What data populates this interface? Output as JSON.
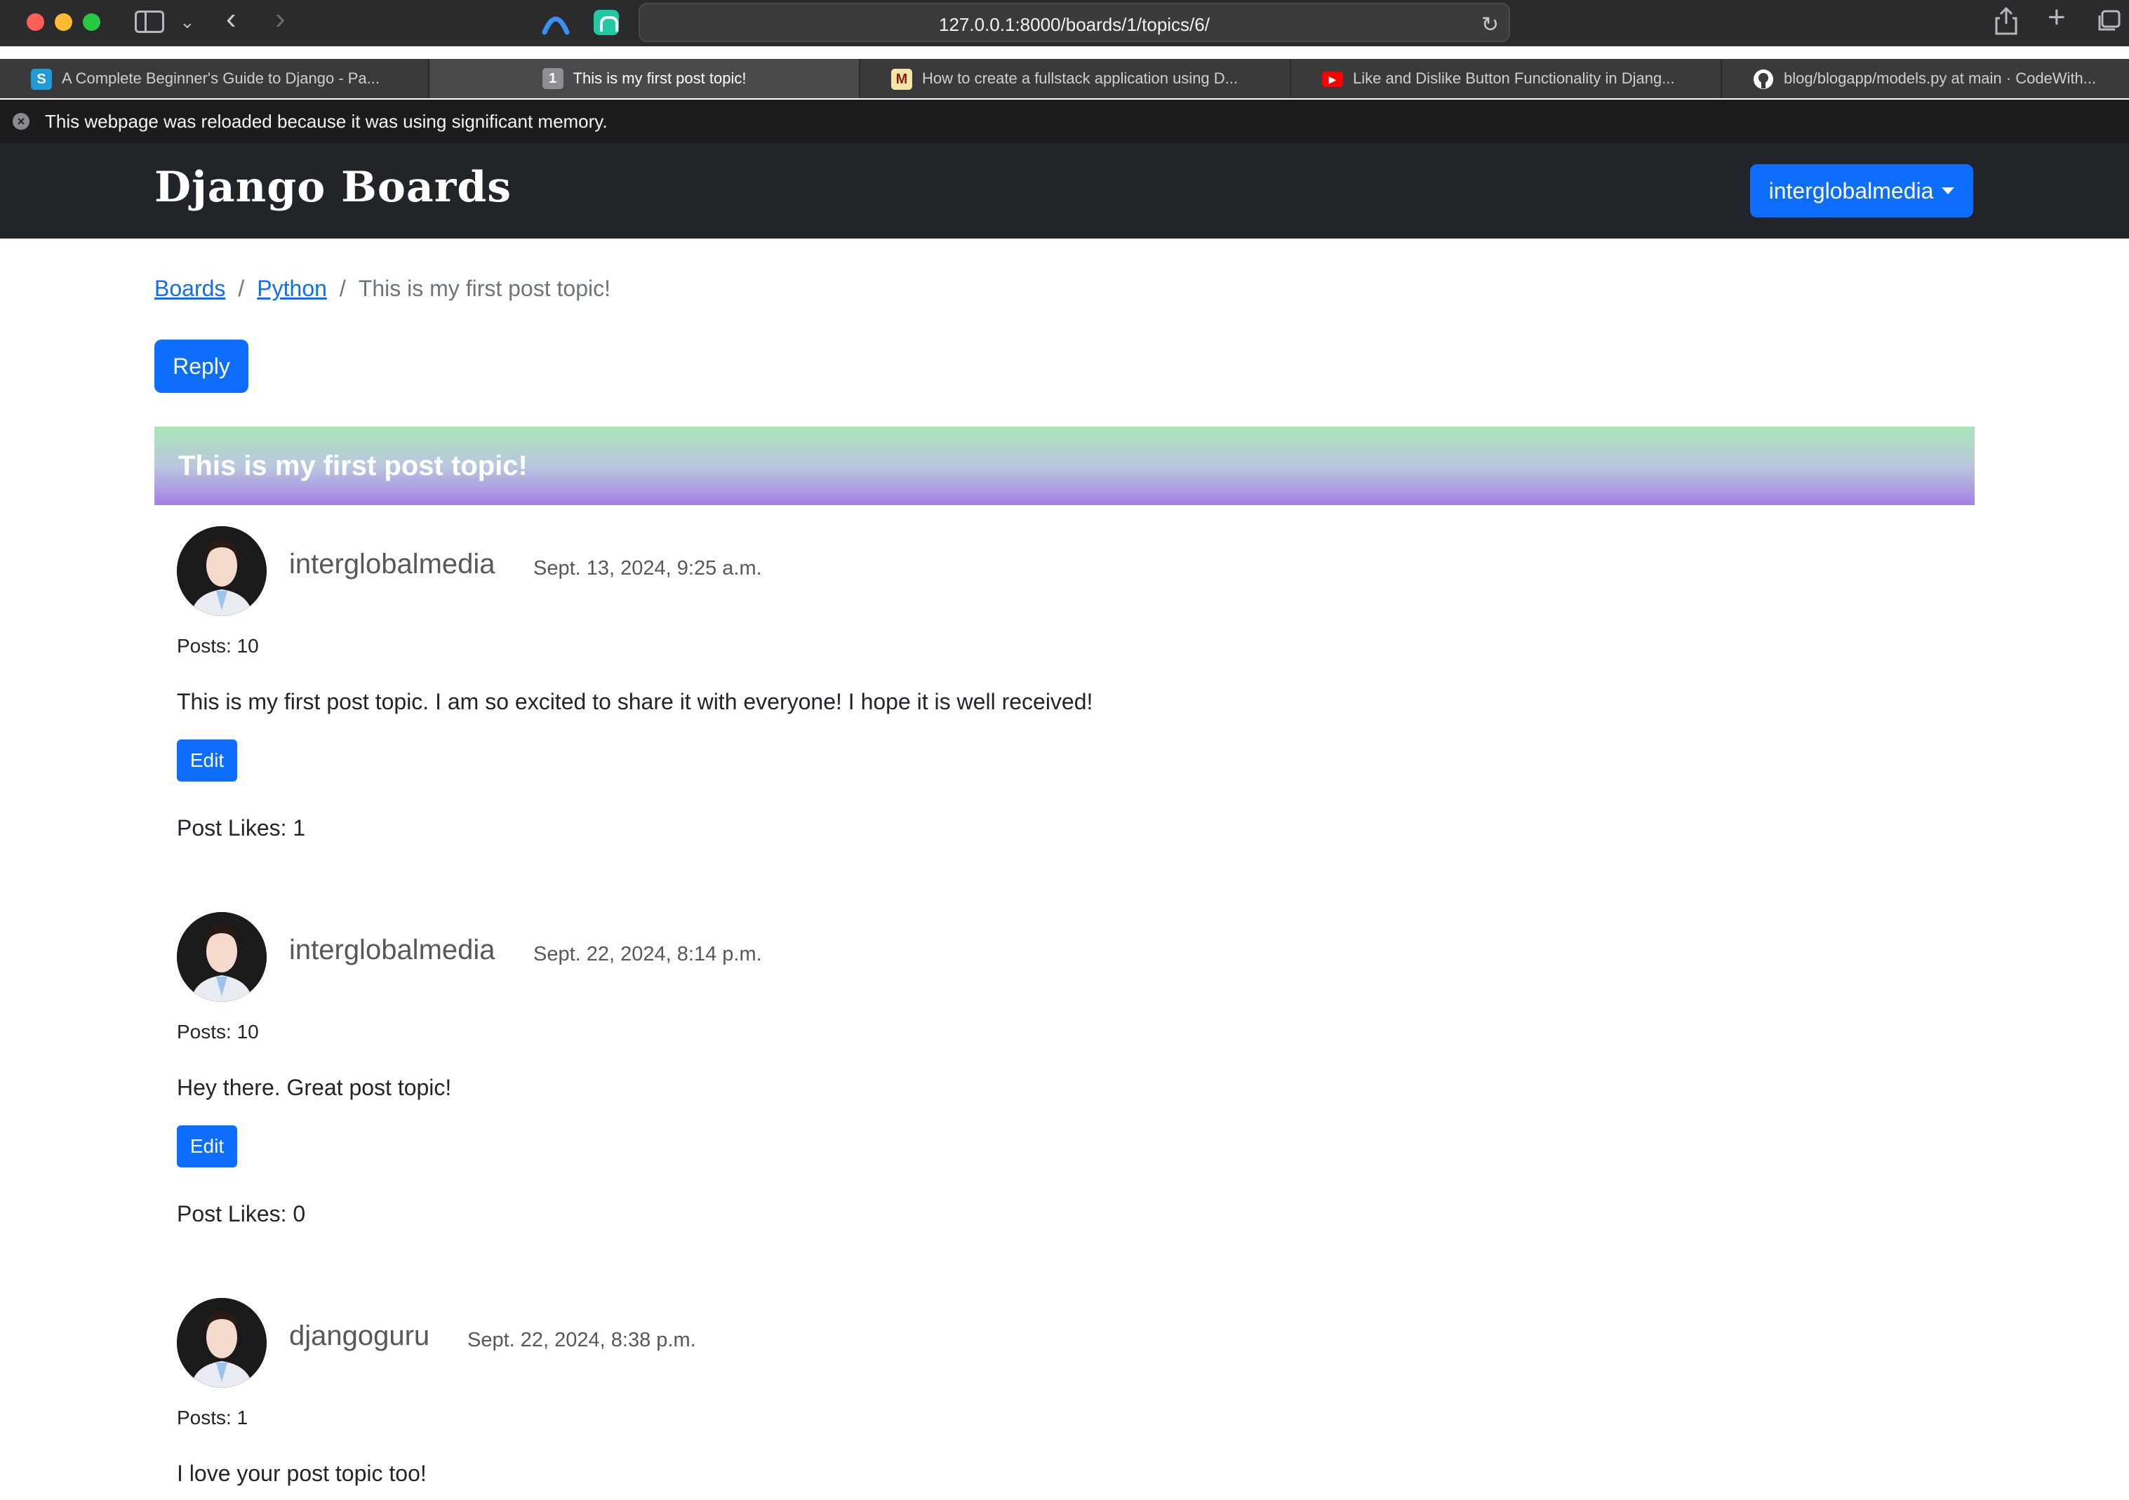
{
  "browser": {
    "url": "127.0.0.1:8000/boards/1/topics/6/",
    "tabs": [
      {
        "label": "A Complete Beginner's Guide to Django - Pa...",
        "favicon": "S",
        "favicon_color": "#1f9bd7"
      },
      {
        "label": "This is my first post topic!",
        "favicon": "1",
        "favicon_color": "#8e8e93",
        "active": true
      },
      {
        "label": "How to create a fullstack application using D...",
        "favicon": "M",
        "favicon_color": "#f5e6a8"
      },
      {
        "label": "Like and Dislike Button Functionality in Djang...",
        "favicon": "▶",
        "favicon_color": "#ff0000"
      },
      {
        "label": "blog/blogapp/models.py at main · CodeWith...",
        "favicon": "github-icon",
        "favicon_color": "#ffffff"
      }
    ],
    "notice": "This webpage was reloaded because it was using significant memory."
  },
  "navbar": {
    "brand": "Django Boards",
    "user_menu": "interglobalmedia"
  },
  "breadcrumb": {
    "boards": "Boards",
    "board": "Python",
    "sep": "/",
    "current": "This is my first post topic!"
  },
  "reply_label": "Reply",
  "topic_title": "This is my first post topic!",
  "edit_label": "Edit",
  "posts": [
    {
      "username": "interglobalmedia",
      "date": "Sept. 13, 2024, 9:25 a.m.",
      "count": "Posts: 10",
      "message": "This is my first post topic. I am so excited to share it with everyone! I hope it is well received!",
      "likes": "Post Likes: 1"
    },
    {
      "username": "interglobalmedia",
      "date": "Sept. 22, 2024, 8:14 p.m.",
      "count": "Posts: 10",
      "message": "Hey there. Great post topic!",
      "likes": "Post Likes: 0"
    },
    {
      "username": "djangoguru",
      "date": "Sept. 22, 2024, 8:38 p.m.",
      "count": "Posts: 1",
      "message": "I love your post topic too!"
    }
  ],
  "colors": {
    "primary": "#0d6efd",
    "navbar": "#212529"
  }
}
